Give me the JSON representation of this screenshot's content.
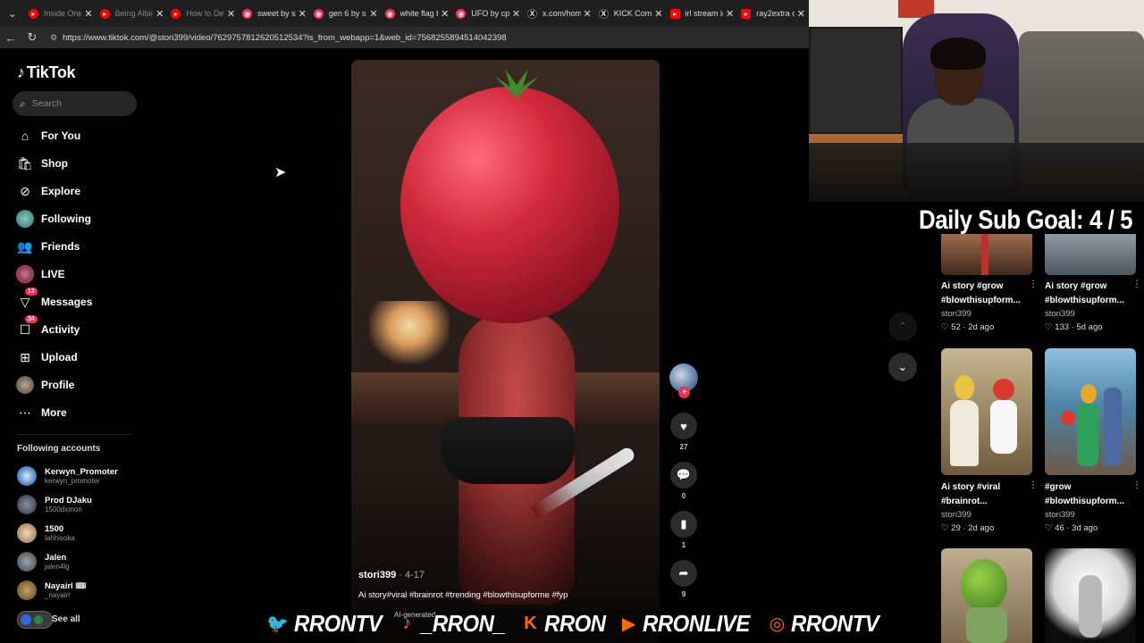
{
  "browser": {
    "tabs": [
      {
        "title": "Inside One",
        "color": "#ff0000"
      },
      {
        "title": "Being Albin",
        "color": "#ff0000"
      },
      {
        "title": "How to De",
        "color": "#ff0000"
      },
      {
        "title": "sweet by si",
        "color": "#fe2c55"
      },
      {
        "title": "gen 6 by si",
        "color": "#fe2c55"
      },
      {
        "title": "white flag b",
        "color": "#fe2c55"
      },
      {
        "title": "UFO by cpa",
        "color": "#fe2c55"
      },
      {
        "title": "x.com/hom",
        "color": "#000000"
      },
      {
        "title": "KICK Comm",
        "color": "#000000"
      },
      {
        "title": "irl stream in",
        "color": "#ff0000"
      },
      {
        "title": "ray2extra d",
        "color": "#ff0000"
      }
    ],
    "url": "https://www.tiktok.com/@stori399/video/7629757812620512534?is_from_webapp=1&web_id=7568255894514042398"
  },
  "sidebar": {
    "logo": "TikTok",
    "search_placeholder": "Search",
    "nav": [
      {
        "label": "For You",
        "icon": "home-icon"
      },
      {
        "label": "Shop",
        "icon": "shopping-bag-icon"
      },
      {
        "label": "Explore",
        "icon": "compass-icon"
      },
      {
        "label": "Following",
        "icon": "following-avatar-icon"
      },
      {
        "label": "Friends",
        "icon": "friends-icon"
      },
      {
        "label": "LIVE",
        "icon": "live-avatar-icon"
      },
      {
        "label": "Messages",
        "icon": "messages-icon",
        "badge": "12"
      },
      {
        "label": "Activity",
        "icon": "activity-icon",
        "badge": "34"
      },
      {
        "label": "Upload",
        "icon": "upload-icon"
      },
      {
        "label": "Profile",
        "icon": "profile-avatar-icon"
      },
      {
        "label": "More",
        "icon": "more-dots-icon"
      }
    ],
    "following_title": "Following accounts",
    "accounts": [
      {
        "name": "Kerwyn_Promoter",
        "handle": "kerwyn_promoter"
      },
      {
        "name": "Prod DJaku",
        "handle": "1500dxmon"
      },
      {
        "name": "1500",
        "handle": "lahhisoka"
      },
      {
        "name": "Jalen",
        "handle": "jalen4lg"
      },
      {
        "name": "Nayairl 🎟",
        "handle": "_nayairl"
      }
    ],
    "see_all": "See all"
  },
  "video": {
    "username": "stori399",
    "date": " · 4-17",
    "caption": "Ai story#viral #brainrot #trending #blowthisupforme #fyp",
    "ai_label": "AI-generated",
    "actions": {
      "likes": "27",
      "comments": "0",
      "saves": "1",
      "shares": "9"
    }
  },
  "overlay": {
    "sub_goal": "Daily Sub Goal: 4 / 5",
    "socials": [
      {
        "icon": "twitter-icon",
        "text": "RRONTV"
      },
      {
        "icon": "tiktok-icon",
        "text": "_RRON_"
      },
      {
        "icon": "kick-icon",
        "text": "RRON"
      },
      {
        "icon": "youtube-icon",
        "text": "RRONLIVE"
      },
      {
        "icon": "instagram-icon",
        "text": "RRONTV"
      }
    ]
  },
  "grid": [
    {
      "title": "Ai story #grow #blowthisupform...",
      "user": "stori399",
      "stats": "♡ 52 · 2d ago"
    },
    {
      "title": "Ai story #grow #blowthisupform...",
      "user": "stori399",
      "stats": "♡ 133 · 5d ago"
    },
    {
      "title": "Ai story #viral #brainrot...",
      "user": "stori399",
      "stats": "♡ 29 · 2d ago"
    },
    {
      "title": "#grow #blowthisupform...",
      "user": "stori399",
      "stats": "♡ 46 · 3d ago"
    }
  ]
}
